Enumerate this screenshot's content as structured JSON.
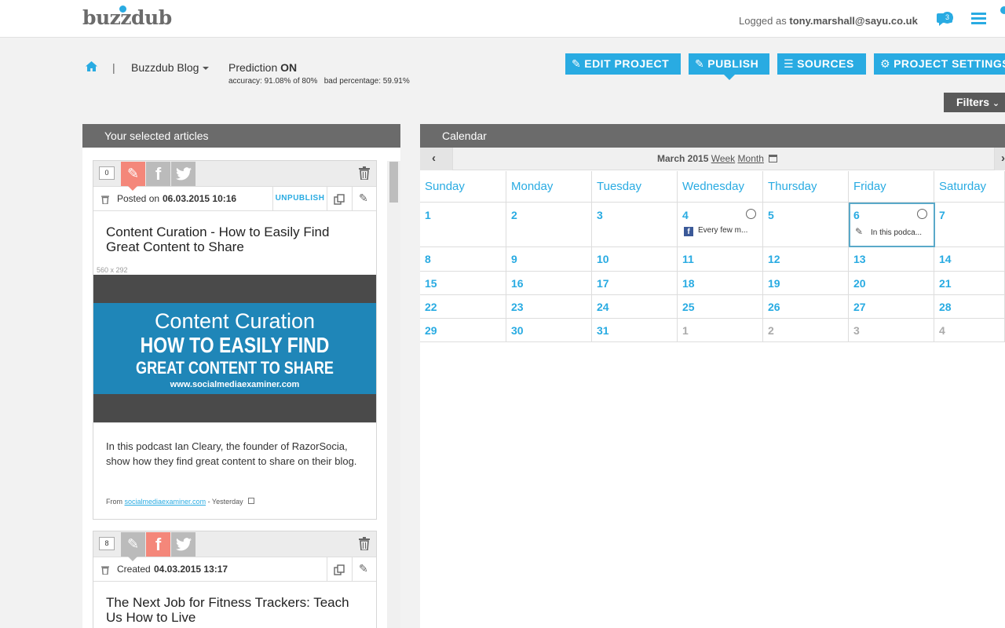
{
  "header": {
    "logo_text": "buzzdub",
    "logged_prefix": "Logged as",
    "user_email": "tony.marshall@sayu.co.uk",
    "notifications_count": "3"
  },
  "project": {
    "separator": "|",
    "name": "Buzzdub Blog",
    "prediction_label": "Prediction",
    "prediction_state": "ON",
    "stats": "accuracy: 91.08% of 80%   bad percentage: 59.91%"
  },
  "actions": {
    "edit_project": "EDIT PROJECT",
    "publish": "PUBLISH",
    "sources": "SOURCES",
    "project_settings": "PROJECT SETTINGS",
    "filters": "Filters"
  },
  "articles_panel": {
    "title": "Your selected articles",
    "cards": [
      {
        "count": "0",
        "status_prefix": "Posted on",
        "status_date": "06.03.2015 10:16",
        "unpublish": "UNPUBLISH",
        "title": "Content Curation - How to Easily Find Great Content to Share",
        "image_size": "560 x 292",
        "image_line1": "Content Curation",
        "image_line2": "HOW TO EASILY FIND",
        "image_line3": "GREAT CONTENT TO SHARE",
        "image_url": "www.socialmediaexaminer.com",
        "excerpt": "In this podcast Ian Cleary, the founder of RazorSocia, show how they find great content to share on their blog.",
        "from_label": "From",
        "source": "socialmediaexaminer.com",
        "when": "- Yesterday"
      },
      {
        "count": "8",
        "status_prefix": "Created",
        "status_date": "04.03.2015 13:17",
        "title": "The Next Job for Fitness Trackers: Teach Us How to Live"
      }
    ]
  },
  "calendar": {
    "title": "Calendar",
    "month_label": "March 2015",
    "view_week": "Week",
    "view_month": "Month",
    "day_names": [
      "Sunday",
      "Monday",
      "Tuesday",
      "Wednesday",
      "Thursday",
      "Friday",
      "Saturday"
    ],
    "weeks": [
      [
        "1",
        "2",
        "3",
        "4",
        "5",
        "6",
        "7"
      ],
      [
        "8",
        "9",
        "10",
        "11",
        "12",
        "13",
        "14"
      ],
      [
        "15",
        "16",
        "17",
        "18",
        "19",
        "20",
        "21"
      ],
      [
        "22",
        "23",
        "24",
        "25",
        "26",
        "27",
        "28"
      ],
      [
        "29",
        "30",
        "31",
        "1",
        "2",
        "3",
        "4"
      ]
    ],
    "events": [
      {
        "day": "4",
        "text": "Every few m..."
      },
      {
        "day": "6",
        "text": "In this podca..."
      }
    ]
  },
  "colors": {
    "accent": "#29abe2",
    "facebook_active": "#f4877a",
    "twitter": "#bbbbbb",
    "panel_header": "#6b6b6b"
  }
}
